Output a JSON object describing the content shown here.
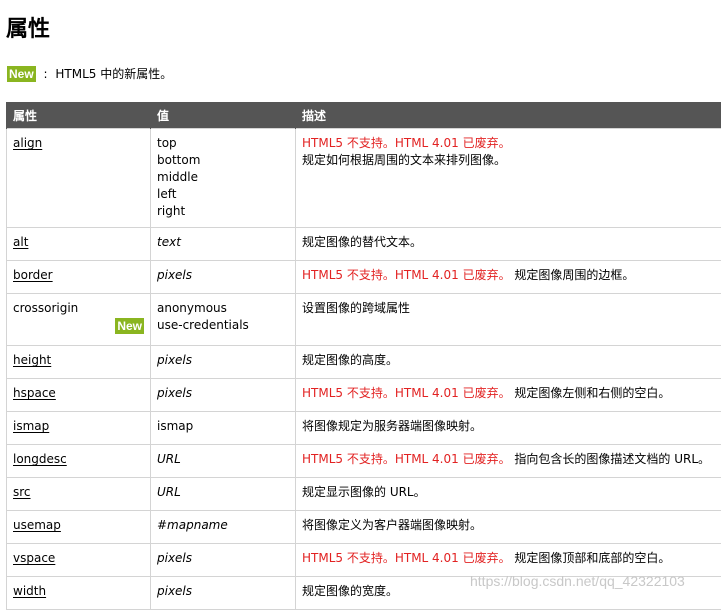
{
  "title": "属性",
  "legend": {
    "badge": "New",
    "separator": ":",
    "text": "HTML5 中的新属性。"
  },
  "table": {
    "headers": [
      "属性",
      "值",
      "描述"
    ],
    "rows": [
      {
        "attr": "align",
        "link": true,
        "values": [
          "top",
          "bottom",
          "middle",
          "left",
          "right"
        ],
        "italic": false,
        "deprecated": "HTML5 不支持。HTML 4.01 已废弃。",
        "desc": "规定如何根据周围的文本来排列图像。"
      },
      {
        "attr": "alt",
        "link": true,
        "values": [
          "text"
        ],
        "italic": true,
        "deprecated": "",
        "desc": "规定图像的替代文本。"
      },
      {
        "attr": "border",
        "link": true,
        "values": [
          "pixels"
        ],
        "italic": true,
        "deprecated": "HTML5 不支持。HTML 4.01 已废弃。",
        "desc": "规定图像周围的边框。"
      },
      {
        "attr": "crossorigin",
        "link": false,
        "badge": "New",
        "values": [
          "anonymous",
          "use-credentials"
        ],
        "italic": false,
        "deprecated": "",
        "desc": "设置图像的跨域属性"
      },
      {
        "attr": "height",
        "link": true,
        "values": [
          "pixels"
        ],
        "italic": true,
        "deprecated": "",
        "desc": "规定图像的高度。"
      },
      {
        "attr": "hspace",
        "link": true,
        "values": [
          "pixels"
        ],
        "italic": true,
        "deprecated": "HTML5 不支持。HTML 4.01 已废弃。",
        "desc": "规定图像左侧和右侧的空白。"
      },
      {
        "attr": "ismap",
        "link": true,
        "values": [
          "ismap"
        ],
        "italic": false,
        "deprecated": "",
        "desc": "将图像规定为服务器端图像映射。"
      },
      {
        "attr": "longdesc",
        "link": true,
        "values": [
          "URL"
        ],
        "italic": true,
        "deprecated": "HTML5 不支持。HTML 4.01 已废弃。",
        "desc": "指向包含长的图像描述文档的 URL。"
      },
      {
        "attr": "src",
        "link": true,
        "values": [
          "URL"
        ],
        "italic": true,
        "deprecated": "",
        "desc": "规定显示图像的 URL。"
      },
      {
        "attr": "usemap",
        "link": true,
        "values": [
          "#mapname"
        ],
        "italic": true,
        "deprecated": "",
        "desc": "将图像定义为客户器端图像映射。"
      },
      {
        "attr": "vspace",
        "link": true,
        "values": [
          "pixels"
        ],
        "italic": true,
        "deprecated": "HTML5 不支持。HTML 4.01 已废弃。",
        "desc": "规定图像顶部和底部的空白。"
      },
      {
        "attr": "width",
        "link": true,
        "values": [
          "pixels"
        ],
        "italic": true,
        "deprecated": "",
        "desc": "规定图像的宽度。"
      }
    ]
  },
  "watermark": "https://blog.csdn.net/qq_42322103"
}
